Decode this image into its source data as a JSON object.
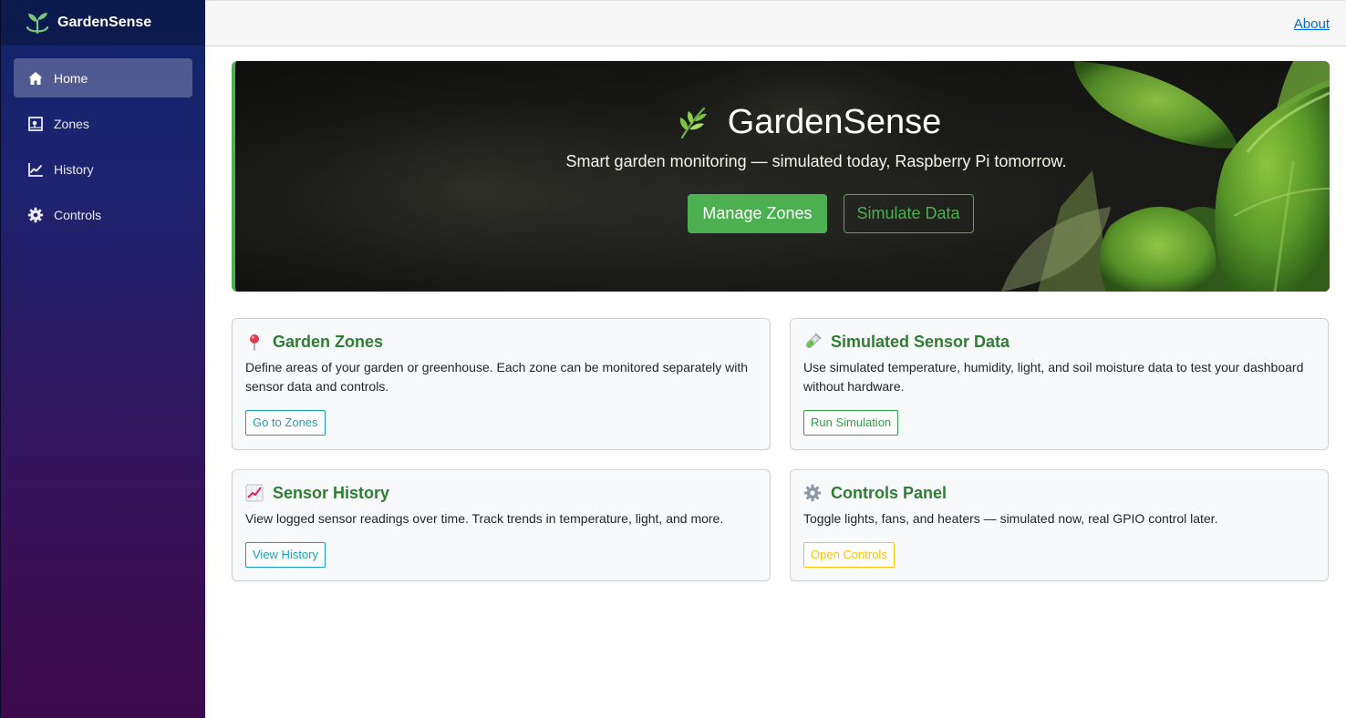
{
  "brand": {
    "name": "GardenSense",
    "logo_icon": "seedling-icon"
  },
  "sidebar": {
    "items": [
      {
        "label": "Home",
        "icon": "home-icon",
        "active": true
      },
      {
        "label": "Zones",
        "icon": "map-frame-icon",
        "active": false
      },
      {
        "label": "History",
        "icon": "line-chart-icon",
        "active": false
      },
      {
        "label": "Controls",
        "icon": "gear-icon",
        "active": false
      }
    ]
  },
  "topbar": {
    "about_label": "About"
  },
  "hero": {
    "title": "GardenSense",
    "subtitle": "Smart garden monitoring — simulated today, Raspberry Pi tomorrow.",
    "primary_button": "Manage Zones",
    "secondary_button": "Simulate Data"
  },
  "cards": [
    {
      "title": "Garden Zones",
      "icon": "pushpin-icon",
      "text": "Define areas of your garden or greenhouse. Each zone can be monitored separately with sensor data and controls.",
      "button": "Go to Zones",
      "button_color": "#17a2b8"
    },
    {
      "title": "Simulated Sensor Data",
      "icon": "test-tube-icon",
      "text": "Use simulated temperature, humidity, light, and soil moisture data to test your dashboard without hardware.",
      "button": "Run Simulation",
      "button_color": "#28a745"
    },
    {
      "title": "Sensor History",
      "icon": "chart-increasing-icon",
      "text": "View logged sensor readings over time. Track trends in temperature, light, and more.",
      "button": "View History",
      "button_color": "#17a2b8"
    },
    {
      "title": "Controls Panel",
      "icon": "gear-icon",
      "text": "Toggle lights, fans, and heaters — simulated now, real GPIO control later.",
      "button": "Open Controls",
      "button_color": "#ffc107"
    }
  ],
  "colors": {
    "accent_green": "#4caf50",
    "card_title_green": "#2e7d32",
    "link_blue": "#0366d6"
  }
}
